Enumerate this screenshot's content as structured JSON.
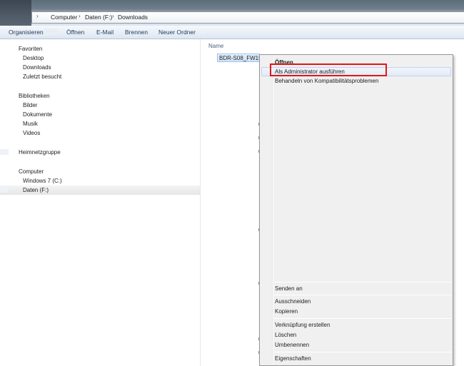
{
  "address_bar": {
    "crumbs": [
      "Computer",
      "Daten (F:)",
      "Downloads"
    ]
  },
  "toolbar": {
    "organize": "Organisieren",
    "open": "Öffnen",
    "email": "E-Mail",
    "burn": "Brennen",
    "new_folder": "Neuer Ordner"
  },
  "nav": {
    "favorites": {
      "header": "Favoriten",
      "items": [
        "Desktop",
        "Downloads",
        "Zuletzt besucht"
      ]
    },
    "libraries": {
      "header": "Bibliotheken",
      "items": [
        "Bilder",
        "Dokumente",
        "Musik",
        "Videos"
      ]
    },
    "homegroup": {
      "header": "Heimnetzgruppe"
    },
    "computer": {
      "header": "Computer",
      "items": [
        "Windows 7 (C:)",
        "Daten (F:)"
      ]
    }
  },
  "content": {
    "column_name": "Name",
    "file_name": "BDR-S08_FW150EU"
  },
  "context_menu": {
    "open": "Öffnen",
    "run_as_admin": "Als Administrator ausführen",
    "compat": "Behandeln von Kompatibilitätsproblemen",
    "send_to": "Senden an",
    "cut": "Ausschneiden",
    "copy": "Kopieren",
    "create_shortcut": "Verknüpfung erstellen",
    "delete": "Löschen",
    "rename": "Umbenennen",
    "properties": "Eigenschaften"
  },
  "colors": {
    "highlight_box": "#e0171b",
    "toolbar_text": "#1e395b"
  }
}
